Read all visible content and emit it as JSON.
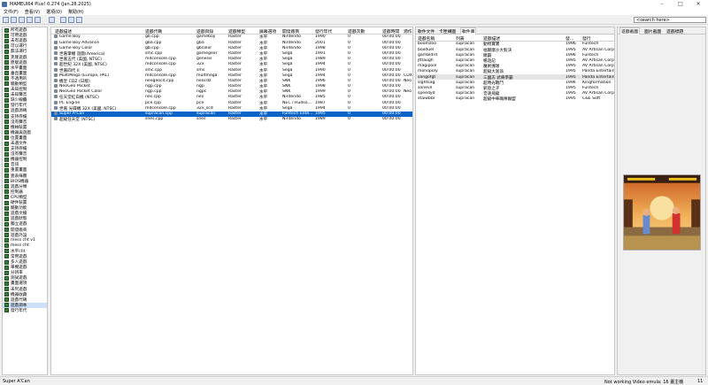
{
  "window": {
    "title": "MAMEUI64 Plus! 0.274 (Jan.28.2025)",
    "minimize": "–",
    "maximize": "□",
    "close": "✕"
  },
  "menu": [
    "文件(F)",
    "查看(V)",
    "選項(O)",
    "幫助(H)"
  ],
  "search": {
    "value": "<search here>"
  },
  "folders": [
    "所有遊戲",
    "可用遊戲",
    "未有遊戲",
    "可以運行",
    "無法運行",
    "克隆遊戲",
    "原版遊戲",
    "水平畫面",
    "垂直畫面",
    "不適用的",
    "驅動類型",
    "未知控制",
    "未知聲音",
    "缺少線纜",
    "發行年代",
    "遊戲源碼",
    "支持存檔",
    "沒有聲音",
    "機械裝置",
    "機器與遊戲",
    "位置畫面",
    "未選文件",
    "支持存檔",
    "沒有聲音",
    "機器控制",
    "音訊",
    "重置畫面",
    "壹表綠圖",
    "BIOS機器",
    "遊戲分類",
    "控制器",
    "CPU類型",
    "硬件裝置",
    "驅動功能",
    "遊戲文檔",
    "遊戲狀態",
    "獨立遊戲",
    "開發廠商",
    "遊戲外設",
    "mess cht v1",
    "mess cht",
    "水平cht",
    "常用遊戲",
    "多人遊戲",
    "單機遊戲",
    "分辨率",
    "測試遊戲",
    "畫面選項",
    "未列遊戲",
    "機器收藏",
    "遊戲代碼",
    "遊戲源本",
    "發行年代"
  ],
  "folders_selected": 51,
  "game_columns": [
    "遊戲描述",
    "遊戲代碼",
    "遊戲目錄",
    "遊戲類型",
    "屏幕選項",
    "開發廠商",
    "發行年代",
    "遊戲次數",
    "遊戲時間",
    "源作"
  ],
  "games": [
    [
      "Game Boy",
      "gb.cpp",
      "gameboy",
      "Raster",
      "水平",
      "Nintendo",
      "1990",
      "0",
      "00:00:00",
      ""
    ],
    [
      "Game Boy Advance",
      "gba.cpp",
      "gba",
      "Raster",
      "水平",
      "Nintendo",
      "2001",
      "0",
      "00:00:00",
      ""
    ],
    [
      "Game Boy Color",
      "gb.cpp",
      "gbcolor",
      "Raster",
      "水平",
      "Nintendo",
      "1998",
      "0",
      "00:00:00",
      ""
    ],
    [
      "世嘉掌機 遊戲(America)",
      "smc.cpp",
      "gamegear",
      "Raster",
      "水平",
      "Sega",
      "1991",
      "0",
      "00:00:00",
      ""
    ],
    [
      "世嘉五代 (美國, NTSC)",
      "mdconsole.cpp",
      "genesis",
      "Raster",
      "水平",
      "Sega",
      "1989",
      "0",
      "00:00:00",
      ""
    ],
    [
      "超世紀 32X (美國, NTSC)",
      "mdconsole.cpp",
      "32x",
      "Raster",
      "水平",
      "Sega",
      "1994",
      "0",
      "00:00:00",
      ""
    ],
    [
      "世嘉四代 II",
      "smc.cpp",
      "sms",
      "Raster",
      "水平",
      "Sega",
      "1990",
      "0",
      "00:00:00",
      ""
    ],
    [
      "MultiMega (Europe, PAL)",
      "mdconsole.cpp",
      "multmega",
      "Raster",
      "水平",
      "Sega",
      "1994",
      "0",
      "00:00:00",
      "CDX"
    ],
    [
      "機皇 CDZ (日版)",
      "neogeocd.cpp",
      "neocdz",
      "Raster",
      "水平",
      "SNK",
      "1996",
      "0",
      "00:00:00",
      "Neo"
    ],
    [
      "NeoGeo Pocket",
      "ngp.cpp",
      "ngp",
      "Raster",
      "水平",
      "SNK",
      "1998",
      "0",
      "00:00:00",
      ""
    ],
    [
      "NeoGeo Pocket Color",
      "ngp.cpp",
      "ngpc",
      "Raster",
      "水平",
      "SNK",
      "1999",
      "0",
      "00:00:00",
      "Neo"
    ],
    [
      "任天堂紅白機 (NTSC)",
      "nes.cpp",
      "nes",
      "Raster",
      "水平",
      "Nintendo",
      "1985",
      "0",
      "00:00:00",
      ""
    ],
    [
      "PC Engine",
      "pce.cpp",
      "pce",
      "Raster",
      "水平",
      "NEC / Hudso...",
      "1987",
      "0",
      "00:00:00",
      ""
    ],
    [
      "世嘉 光碟機 32X (美國, NTSC)",
      "mdconsole.cpp",
      "32x_scd",
      "Raster",
      "水平",
      "Sega",
      "1994",
      "0",
      "00:00:00",
      ""
    ],
    [
      "Super A'Can",
      "supracan.cpp",
      "supracan",
      "Raster",
      "水平",
      "Funtech Ente...",
      "1995",
      "0",
      "00:00:00",
      ""
    ],
    [
      "超級任天堂 (NTSC)",
      "snes.cpp",
      "snes",
      "Raster",
      "水平",
      "Nintendo",
      "1989",
      "0",
      "00:00:00",
      ""
    ]
  ],
  "games_selected": 14,
  "tabs": [
    "軟件文件",
    "卡匣構圖",
    "軟件庫"
  ],
  "tabs_active": 2,
  "soft_columns": [
    "遊戲名稱",
    "列表",
    "遊戲描述",
    "發...",
    "發行"
  ],
  "softs": [
    [
      "boomzoo",
      "supracan",
      "動物寶寶",
      "1996",
      "Funtech"
    ],
    [
      "boxduel",
      "supracan",
      "福爾摩沙大對決",
      "1995",
      "AV Artisan Corp."
    ],
    [
      "gambldrd",
      "supracan",
      "賭霸",
      "1996",
      "Funtech"
    ],
    [
      "jttlaugh",
      "supracan",
      "暢遊記",
      "1995",
      "AV Artisan Corp."
    ],
    [
      "magipool",
      "supracan",
      "魔術撞球",
      "1995",
      "AV Artisan Corp."
    ],
    [
      "monopoly",
      "supracan",
      "超級大富翁",
      "1995",
      "Panda Entertainment"
    ],
    [
      "sangofgt",
      "supracan",
      "三國志 武將爭霸",
      "1995",
      "Panda Entertainment"
    ],
    [
      "slghtsag",
      "supracan",
      "超時光戰鬥",
      "1996",
      "Kingformation"
    ],
    [
      "sonevil",
      "supracan",
      "邪惡之子",
      "1995",
      "Funtech"
    ],
    [
      "speedyd",
      "supracan",
      "音速飛龍",
      "1995",
      "AV Artisan Corp."
    ],
    [
      "staiwbbl",
      "supracan",
      "超級中華職棒聯盟",
      "1995",
      "C&E Soft"
    ]
  ],
  "softs_selected": 6,
  "snap_tabs": [
    "遊戲截圖",
    "圖片截圖",
    "遊戲標題"
  ],
  "status": {
    "left": "Super A'Can",
    "right": "Not working  Video emula: 16 畫主機",
    "count": "11"
  }
}
